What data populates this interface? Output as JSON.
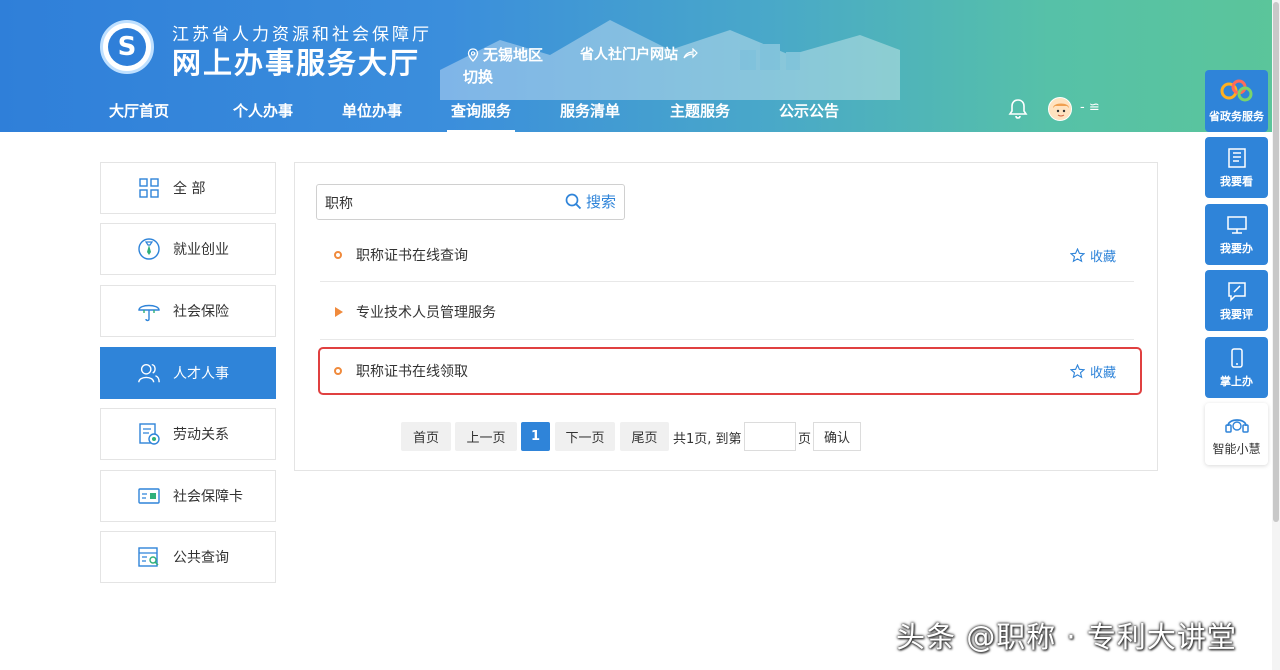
{
  "header": {
    "org_name": "江苏省人力资源和社会保障厅",
    "hall_name": "网上办事服务大厅",
    "logo_glyph": "S",
    "region": "无锡地区",
    "switch_label": "切换",
    "portal_link": "省人社门户网站",
    "user_name": "- ≌"
  },
  "nav": {
    "items": [
      {
        "label": "大厅首页"
      },
      {
        "label": "个人办事"
      },
      {
        "label": "单位办事"
      },
      {
        "label": "查询服务",
        "active": true
      },
      {
        "label": "服务清单"
      },
      {
        "label": "主题服务"
      },
      {
        "label": "公示公告"
      }
    ]
  },
  "sidebar": {
    "items": [
      {
        "label": "全 部",
        "icon": "grid-icon"
      },
      {
        "label": "就业创业",
        "icon": "employment-icon"
      },
      {
        "label": "社会保险",
        "icon": "umbrella-icon"
      },
      {
        "label": "人才人事",
        "icon": "people-icon",
        "active": true
      },
      {
        "label": "劳动关系",
        "icon": "labor-doc-icon"
      },
      {
        "label": "社会保障卡",
        "icon": "card-icon"
      },
      {
        "label": "公共查询",
        "icon": "query-icon"
      }
    ]
  },
  "search": {
    "value": "职称",
    "button_label": "搜索"
  },
  "results": {
    "items": [
      {
        "title": "职称证书在线查询",
        "fav": "收藏"
      },
      {
        "title": "专业技术人员管理服务"
      },
      {
        "title": "职称证书在线领取",
        "fav": "收藏"
      }
    ]
  },
  "pagination": {
    "first": "首页",
    "prev": "上一页",
    "current": "1",
    "next": "下一页",
    "last": "尾页",
    "summary": "共1页, 到第",
    "page_suffix": "页",
    "confirm": "确认"
  },
  "float_bar": {
    "items": [
      {
        "label": "省政务服务"
      },
      {
        "label": "我要看"
      },
      {
        "label": "我要办"
      },
      {
        "label": "我要评"
      },
      {
        "label": "掌上办"
      },
      {
        "label": "智能小慧"
      }
    ]
  },
  "watermark": "头条 @职称 · 专利大讲堂",
  "colors": {
    "primary": "#2f84d9",
    "accent_orange": "#f08a3c",
    "highlight_red": "#e04040"
  }
}
